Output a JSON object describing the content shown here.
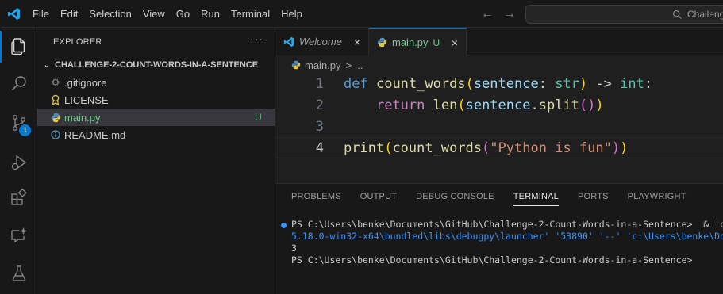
{
  "menu": [
    "File",
    "Edit",
    "Selection",
    "View",
    "Go",
    "Run",
    "Terminal",
    "Help"
  ],
  "search": {
    "text": "Challeng"
  },
  "explorer": {
    "title": "EXPLORER",
    "more": "···",
    "folder": "CHALLENGE-2-COUNT-WORDS-IN-A-SENTENCE",
    "files": [
      {
        "name": ".gitignore",
        "status": ""
      },
      {
        "name": "LICENSE",
        "status": ""
      },
      {
        "name": "main.py",
        "status": "U"
      },
      {
        "name": "README.md",
        "status": ""
      }
    ]
  },
  "activity": {
    "source_control_badge": "1"
  },
  "tabs": [
    {
      "label": "Welcome",
      "close": "×"
    },
    {
      "label": "main.py",
      "status": "U",
      "close": "×"
    }
  ],
  "breadcrumb": {
    "file": "main.py",
    "sep": "> ..."
  },
  "editor": {
    "line_numbers": [
      "1",
      "2",
      "3",
      "4"
    ]
  },
  "panel": {
    "tabs": [
      "PROBLEMS",
      "OUTPUT",
      "DEBUG CONSOLE",
      "TERMINAL",
      "PORTS",
      "PLAYWRIGHT"
    ],
    "active_tab": "TERMINAL",
    "terminal_lines": [
      "PS C:\\Users\\benke\\Documents\\GitHub\\Challenge-2-Count-Words-in-a-Sentence>  & 'c",
      "5.18.0-win32-x64\\bundled\\libs\\debugpy\\launcher' '53890' '--' 'c:\\Users\\benke\\Do",
      "3",
      "PS C:\\Users\\benke\\Documents\\GitHub\\Challenge-2-Count-Words-in-a-Sentence>"
    ]
  },
  "colors": {
    "accent": "#0078d4",
    "untracked": "#73c991",
    "keyword": "#569cd6",
    "function": "#dcdcaa",
    "string": "#ce9178"
  }
}
